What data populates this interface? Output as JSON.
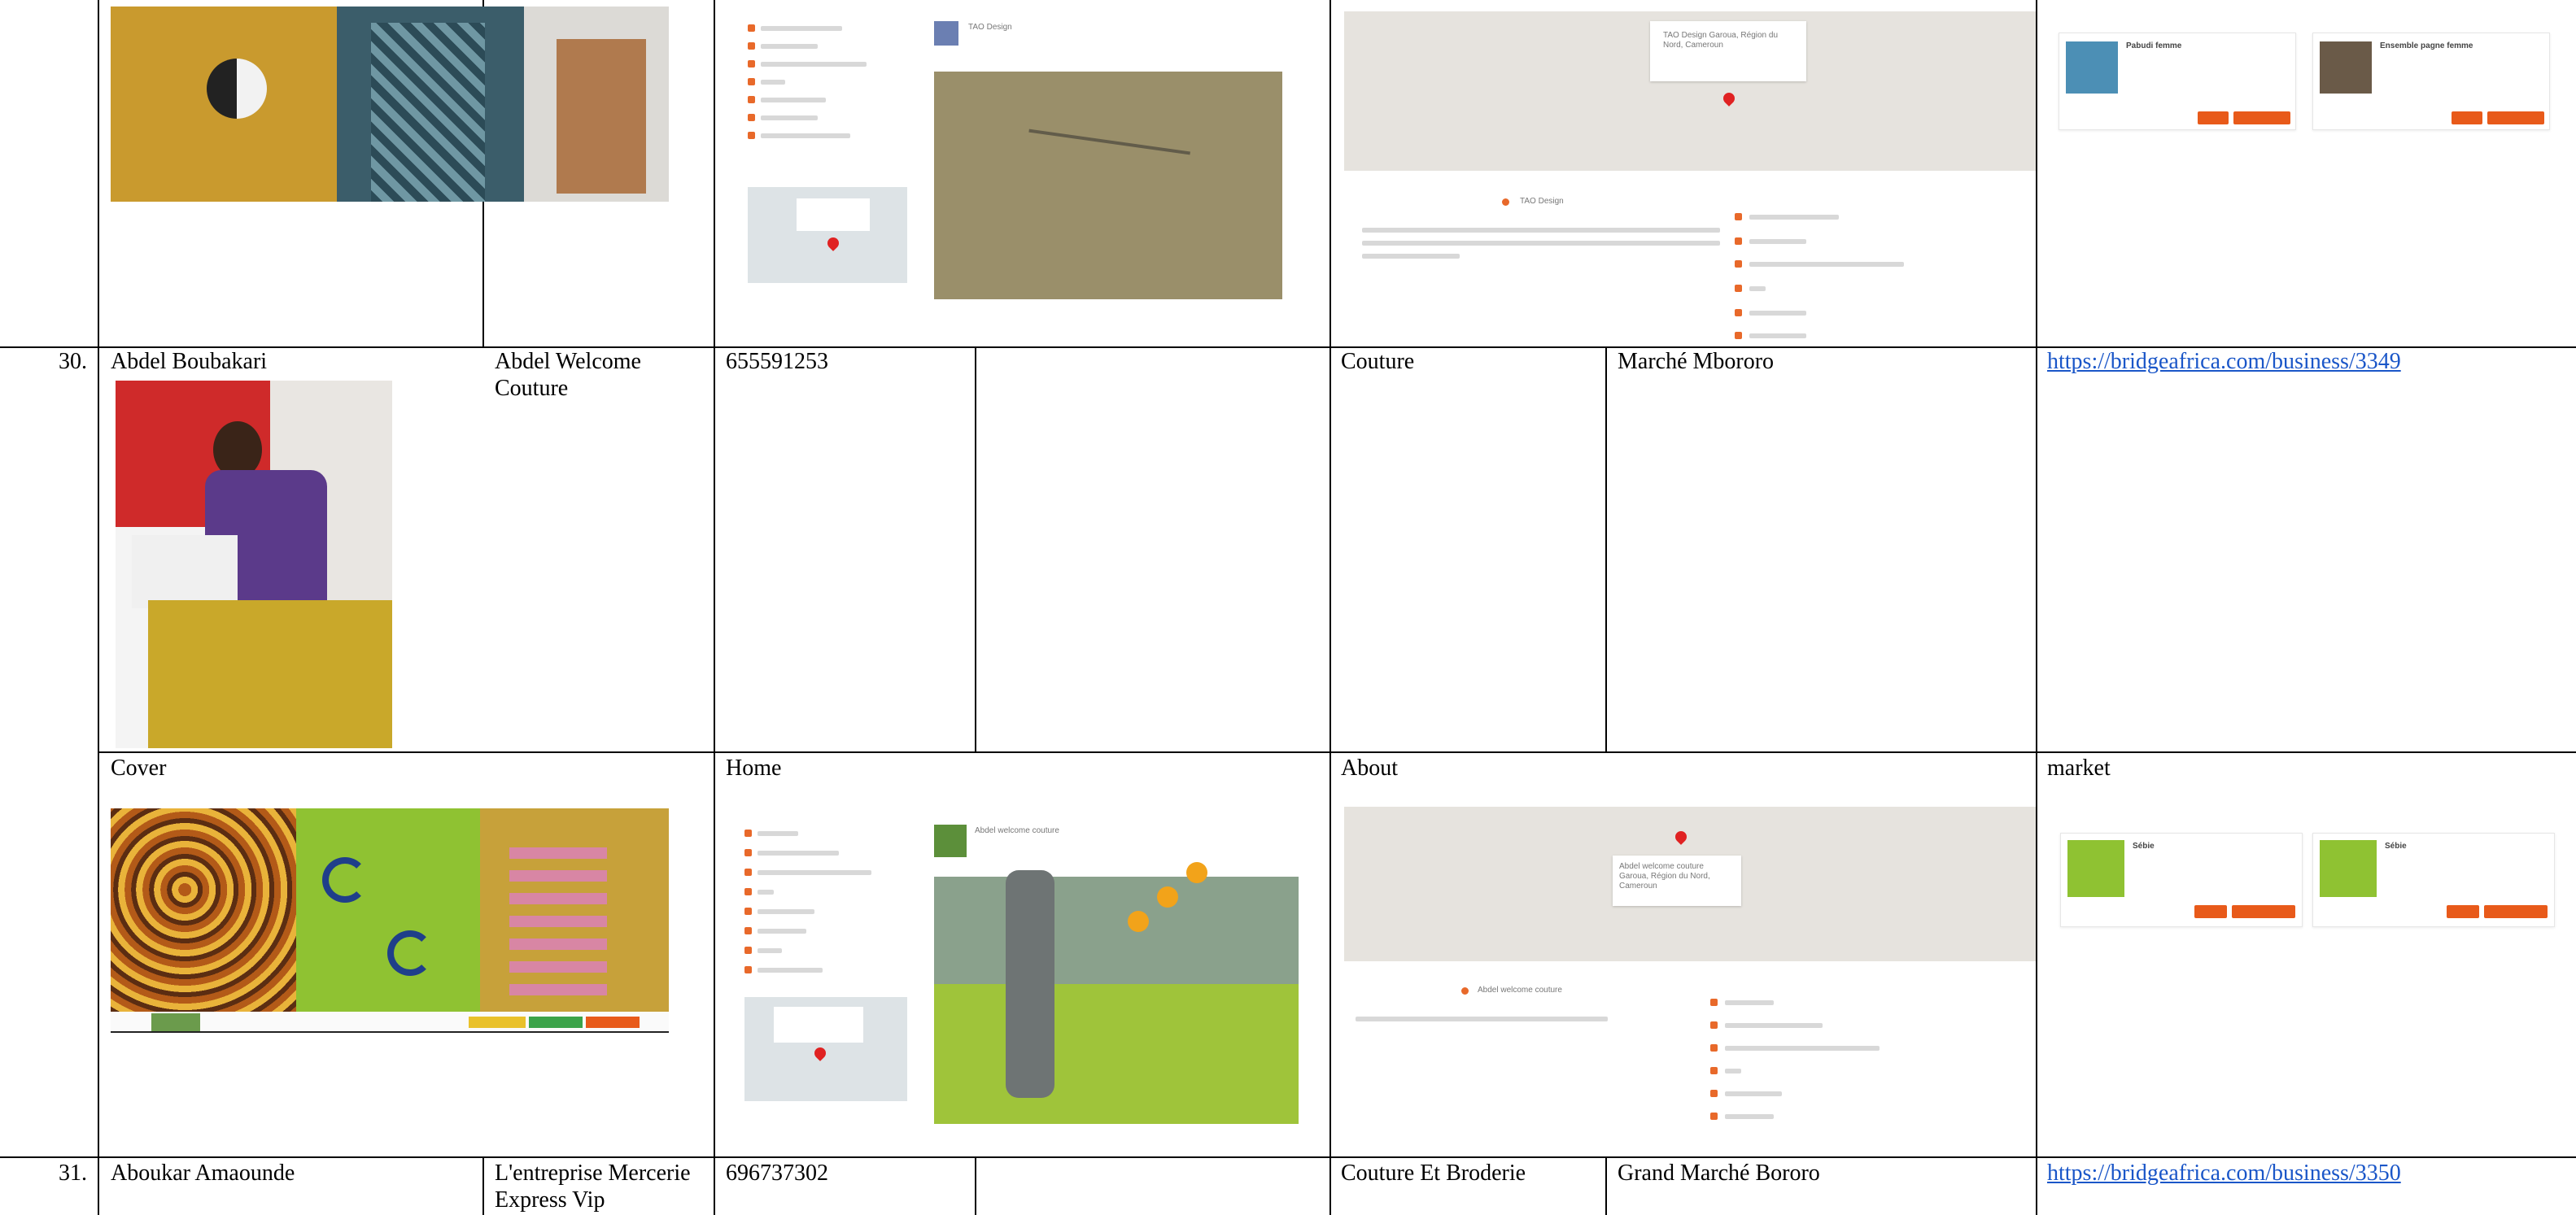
{
  "rows": [
    {
      "number": "30.",
      "name": "Abdel Boubakari",
      "business": "Abdel Welcome Couture",
      "phone": "655591253",
      "category": "Couture",
      "location": "Marché Mbororo",
      "url": "https://bridgeafrica.com/business/3349",
      "sections": [
        "Cover",
        "Home",
        "About",
        "market"
      ],
      "home_card": {
        "title": "Abdel welcome couture",
        "map_caption": "Abdel welcome couture Garoua, Région du Nord, Cameroun"
      },
      "about": {
        "map_caption": "Abdel welcome couture Garoua, Région du Nord, Cameroun",
        "name_label": "Abdel welcome couture"
      },
      "market_items": [
        "Sébie",
        "Sébie"
      ]
    },
    {
      "number": "31.",
      "name": "Aboukar Amaounde",
      "business": "L'entreprise Mercerie Express Vip",
      "phone": "696737302",
      "category": "Couture Et Broderie",
      "location": "Grand Marché Bororo",
      "url": "https://bridgeafrica.com/business/3350"
    }
  ],
  "previous": {
    "about": {
      "map_caption": "TAO Design Garoua, Région du Nord, Cameroun",
      "name_label": "TAO Design"
    },
    "home_card": {
      "title": "TAO Design"
    },
    "market_items": [
      "Pabudi femme",
      "Ensemble pagne femme"
    ]
  },
  "colors": {
    "accent": "#e85a1a",
    "link": "#1a56c8",
    "pin": "#e02222"
  }
}
